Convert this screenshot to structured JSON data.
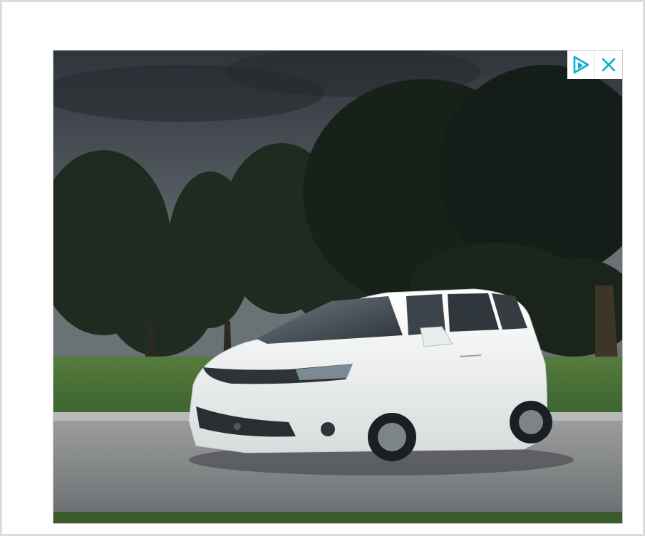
{
  "ad": {
    "controls": {
      "adchoices_icon": "adchoices-triangle-icon",
      "close_icon": "close-x-icon",
      "accent_color": "#00aecd"
    },
    "creative": {
      "subject": "white-minivan",
      "palette": {
        "sky": "#3b4248",
        "foliage": "#1e2a20",
        "grass": "#4f7a3a",
        "road": "#8a8d8f",
        "vehicle": "#f2f4f4"
      }
    }
  }
}
